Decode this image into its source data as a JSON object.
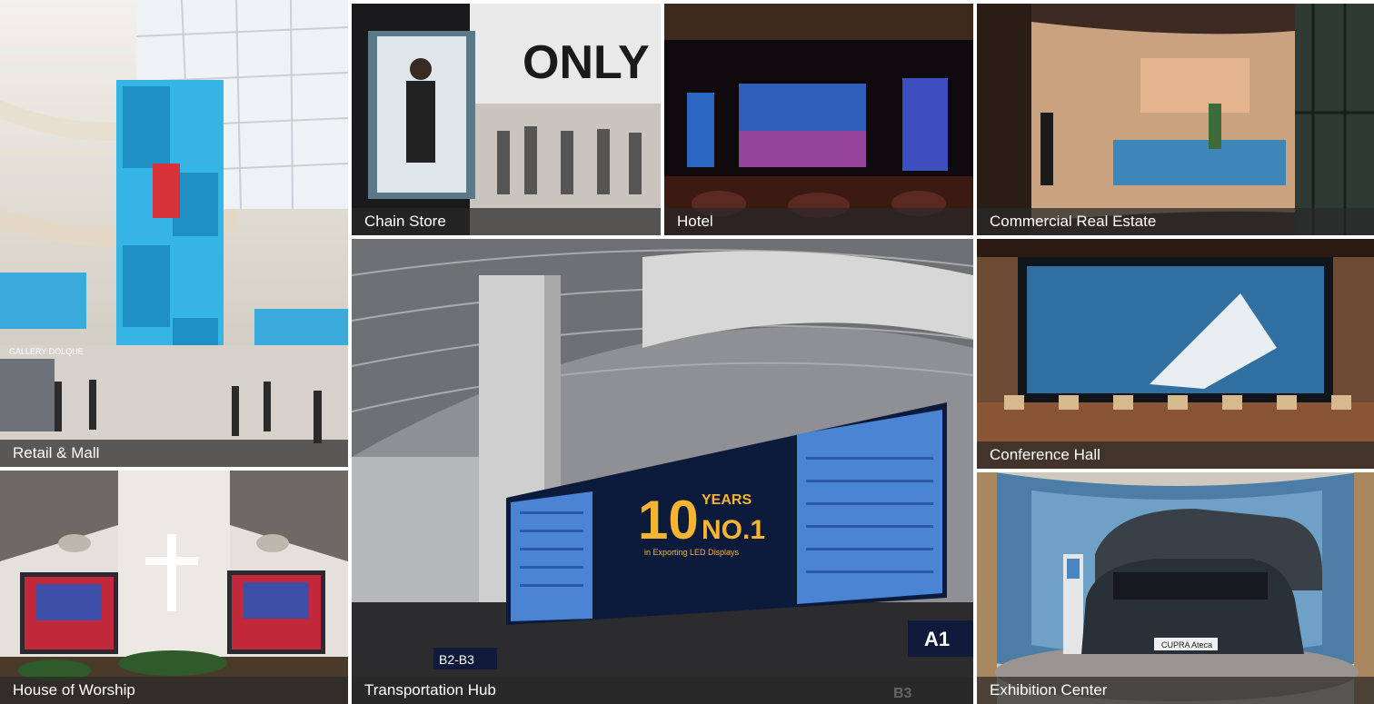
{
  "tiles": [
    {
      "id": "retail",
      "label": "Retail & Mall"
    },
    {
      "id": "chain",
      "label": "Chain Store"
    },
    {
      "id": "hotel",
      "label": "Hotel"
    },
    {
      "id": "cre",
      "label": "Commercial Real Estate"
    },
    {
      "id": "conf",
      "label": "Conference Hall"
    },
    {
      "id": "worship",
      "label": "House of Worship"
    },
    {
      "id": "transport",
      "label": "Transportation Hub"
    },
    {
      "id": "exhib",
      "label": "Exhibition Center"
    }
  ],
  "scene_text": {
    "store_sign": "ONLY",
    "transport_years": "10",
    "transport_years_word": "YEARS",
    "transport_no1": "NO.1",
    "transport_sub": "in Exporting LED Displays",
    "gate_a1": "A1",
    "gate_b2b3": "B2-B3",
    "gate_b3": "B3",
    "retail_store": "GALLERY DOLQUE",
    "exhib_plate": "CUPRA Ateca"
  }
}
